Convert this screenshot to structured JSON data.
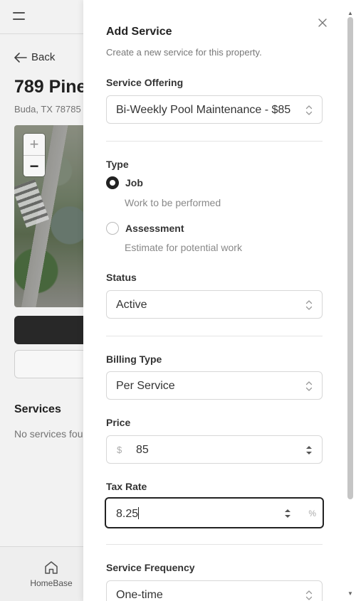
{
  "background": {
    "back_label": "Back",
    "property_title": "789 Pine",
    "address": "Buda, TX 78785",
    "map_zoom_in": "+",
    "map_zoom_out": "−",
    "services_heading": "Services",
    "no_services": "No services fou",
    "nav": {
      "home_label": "HomeBase"
    }
  },
  "sheet": {
    "title": "Add Service",
    "subtitle": "Create a new service for this property.",
    "service_offering": {
      "label": "Service Offering",
      "value": "Bi-Weekly Pool Maintenance - $85"
    },
    "type": {
      "label": "Type",
      "options": [
        {
          "label": "Job",
          "description": "Work to be performed",
          "checked": true
        },
        {
          "label": "Assessment",
          "description": "Estimate for potential work",
          "checked": false
        }
      ]
    },
    "status": {
      "label": "Status",
      "value": "Active"
    },
    "billing_type": {
      "label": "Billing Type",
      "value": "Per Service"
    },
    "price": {
      "label": "Price",
      "prefix": "$",
      "value": "85"
    },
    "tax_rate": {
      "label": "Tax Rate",
      "value": "8.25",
      "suffix": "%"
    },
    "service_frequency": {
      "label": "Service Frequency",
      "value": "One-time"
    }
  },
  "colors": {
    "accent": "#222222",
    "border": "#d7d7d7",
    "muted": "#777777"
  }
}
